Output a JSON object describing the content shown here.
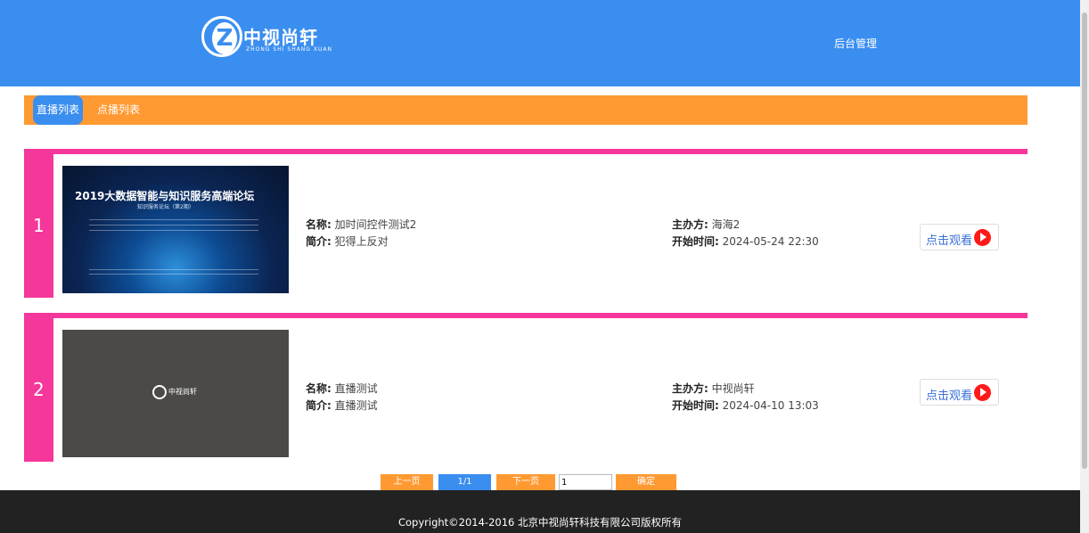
{
  "header": {
    "logo_text": "中视尚轩",
    "logo_sub": "ZHONG SHI SHANG XUAN",
    "admin_link": "后台管理"
  },
  "tabs": [
    {
      "label": "直播列表",
      "active": true
    },
    {
      "label": "点播列表",
      "active": false
    }
  ],
  "items": [
    {
      "index": "1",
      "thumb_title": "2019大数据智能与知识服务高端论坛",
      "thumb_sub": "知识服务论坛（第2期）",
      "name_label": "名称:",
      "name": "加时间控件测试2",
      "intro_label": "简介:",
      "intro": "犯得上反对",
      "organizer_label": "主办方:",
      "organizer": "海海2",
      "start_label": "开始时间:",
      "start": "2024-05-24 22:30",
      "watch_label": "点击观看"
    },
    {
      "index": "2",
      "thumb_logo": "中视尚轩",
      "name_label": "名称:",
      "name": "直播测试",
      "intro_label": "简介:",
      "intro": "直播测试",
      "organizer_label": "主办方:",
      "organizer": "中视尚轩",
      "start_label": "开始时间:",
      "start": "2024-04-10 13:03",
      "watch_label": "点击观看"
    }
  ],
  "pager": {
    "prev": "上一页",
    "page": "1/1",
    "next": "下一页",
    "input_value": "1",
    "confirm": "确定"
  },
  "footer": {
    "copyright": "Copyright©2014-2016 北京中视尚轩科技有限公司版权所有"
  },
  "colors": {
    "header_blue": "#3a8ef0",
    "tab_orange": "#ff9a33",
    "item_pink": "#f5369a",
    "footer_dark": "#222222",
    "play_red": "#ff1a1a"
  }
}
